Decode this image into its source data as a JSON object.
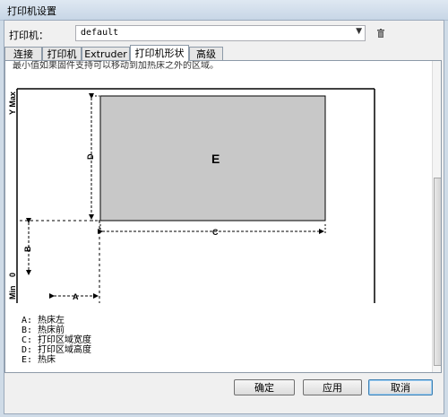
{
  "window": {
    "title": "打印机设置"
  },
  "printer": {
    "label": "打印机：",
    "selected": "default"
  },
  "tabs": [
    {
      "label": "连接"
    },
    {
      "label": "打印机"
    },
    {
      "label": "Extruder"
    },
    {
      "label": "打印机形状"
    },
    {
      "label": "高级"
    }
  ],
  "diagram": {
    "top_text": "最小值如果固件支持可以移动到加热床之外的区域。",
    "y_max": "Y Max",
    "zero": "0",
    "min": "Min",
    "letters": {
      "A": "A",
      "B": "B",
      "C": "C",
      "D": "D",
      "E": "E"
    }
  },
  "legend": [
    "A: 热床左",
    "B: 热床前",
    "C: 打印区域宽度",
    "D: 打印区域高度",
    "E: 热床"
  ],
  "buttons": {
    "ok": "确定",
    "apply": "应用",
    "cancel": "取消"
  }
}
